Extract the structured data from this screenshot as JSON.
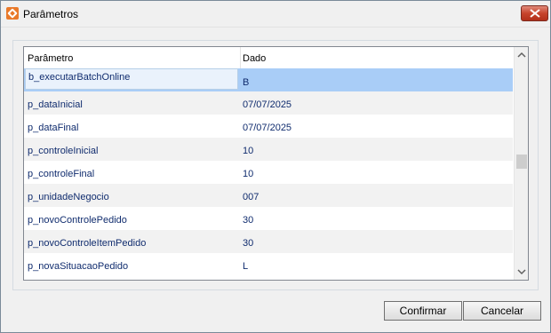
{
  "window": {
    "title": "Parâmetros",
    "icon": "app-icon"
  },
  "grid": {
    "columns": [
      "Parâmetro",
      "Dado"
    ],
    "editing_value": "b_executarBatchOnline",
    "rows": [
      {
        "param": "b_executarBatchOnline",
        "value": "B"
      },
      {
        "param": "p_dataInicial",
        "value": "07/07/2025"
      },
      {
        "param": "p_dataFinal",
        "value": "07/07/2025"
      },
      {
        "param": "p_controleInicial",
        "value": "10"
      },
      {
        "param": "p_controleFinal",
        "value": "10"
      },
      {
        "param": "p_unidadeNegocio",
        "value": "007"
      },
      {
        "param": "p_novoControlePedido",
        "value": "30"
      },
      {
        "param": "p_novoControleItemPedido",
        "value": "30"
      },
      {
        "param": "p_novaSituacaoPedido",
        "value": "L"
      }
    ]
  },
  "buttons": {
    "confirm": "Confirmar",
    "cancel": "Cancelar"
  },
  "colors": {
    "selection": "#a9cdf7",
    "text": "#102c6e"
  }
}
